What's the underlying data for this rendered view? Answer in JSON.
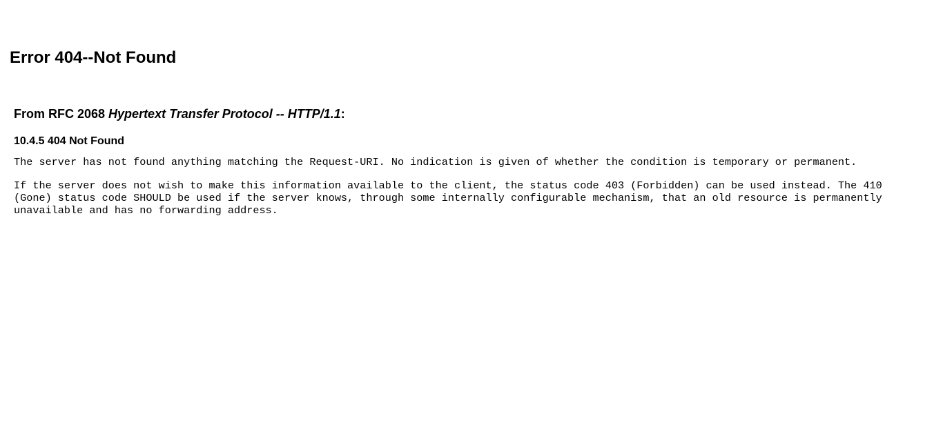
{
  "error": {
    "title": "Error 404--Not Found"
  },
  "rfc": {
    "prefix": "From RFC 2068 ",
    "title": "Hypertext Transfer Protocol -- HTTP/1.1",
    "suffix": ":"
  },
  "section": {
    "heading": "10.4.5 404 Not Found"
  },
  "paragraphs": {
    "p1_line1": "The server has not found anything matching the Request-URI. No indication is given of whether the condition is temporary or permanent.",
    "p2_line1": "If the server does not wish to make this information available to the client, the status code 403 (Forbidden) can be used instead. The 410",
    "p2_line2": "(Gone) status code SHOULD be used if the server knows, through some internally configurable mechanism, that an old resource is permanently",
    "p2_line3": "unavailable and has no forwarding address."
  }
}
